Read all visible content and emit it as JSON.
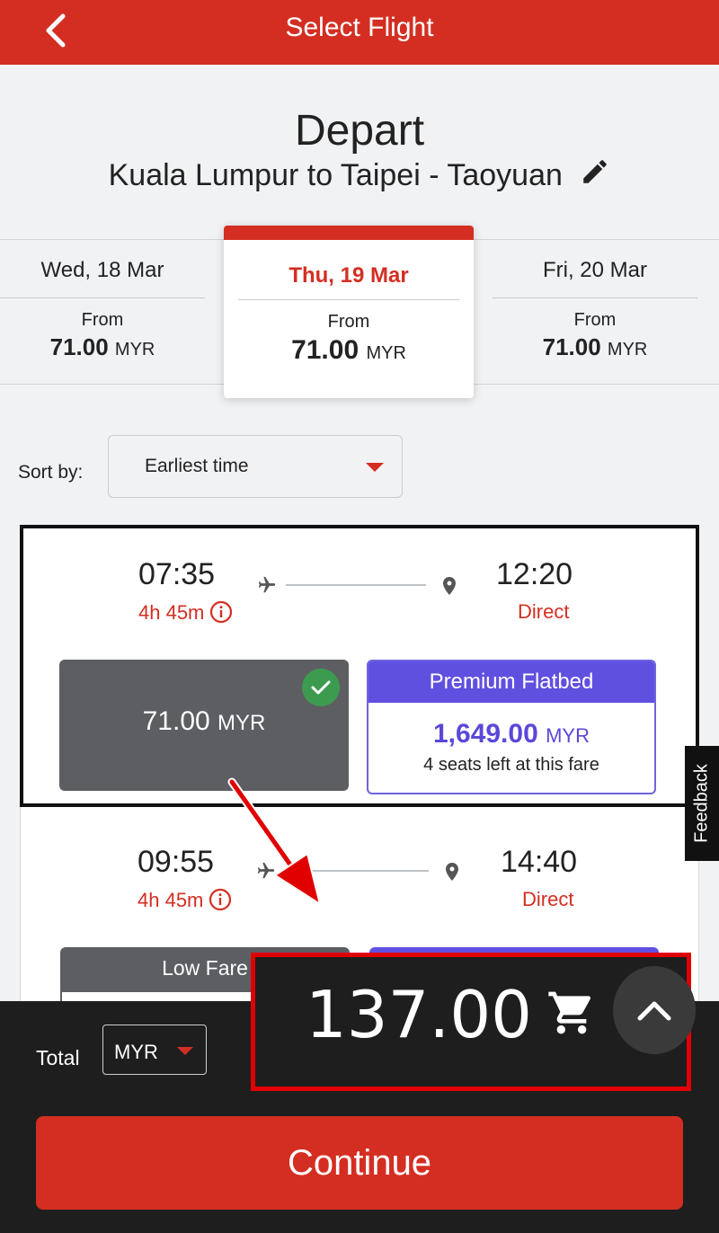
{
  "header": {
    "title": "Select Flight",
    "back_icon": "chevron-left-icon"
  },
  "journey": {
    "direction": "Depart",
    "route": "Kuala Lumpur to Taipei - Taoyuan",
    "edit_icon": "pencil-icon"
  },
  "dates": [
    {
      "label": "Wed, 18 Mar",
      "from_label": "From",
      "price": "71.00",
      "currency": "MYR",
      "selected": false
    },
    {
      "label": "Thu, 19 Mar",
      "from_label": "From",
      "price": "71.00",
      "currency": "MYR",
      "selected": true
    },
    {
      "label": "Fri, 20 Mar",
      "from_label": "From",
      "price": "71.00",
      "currency": "MYR",
      "selected": false
    }
  ],
  "sort": {
    "label": "Sort by:",
    "value": "Earliest time"
  },
  "flights": [
    {
      "depart_time": "07:35",
      "arrive_time": "12:20",
      "duration": "4h 45m",
      "stops": "Direct",
      "fares": {
        "selected": {
          "price": "71.00",
          "currency": "MYR"
        },
        "premium": {
          "title": "Premium Flatbed",
          "price": "1,649.00",
          "currency": "MYR",
          "note": "4 seats left at this fare"
        }
      }
    },
    {
      "depart_time": "09:55",
      "arrive_time": "14:40",
      "duration": "4h 45m",
      "stops": "Direct",
      "fares": {
        "low_fare_label": "Low Fare"
      }
    }
  ],
  "feedback": {
    "label": "Feedback"
  },
  "footer": {
    "total_label": "Total",
    "currency": "MYR",
    "total_amount": "137.00",
    "cart_icon": "cart-icon",
    "expand_icon": "chevron-up-icon",
    "continue_label": "Continue"
  },
  "colors": {
    "brand_red": "#d42e22",
    "premium_purple": "#6050e0",
    "selected_fare_grey": "#5c5e62",
    "check_green": "#3d9b4f",
    "annotation_red": "#e00000"
  }
}
